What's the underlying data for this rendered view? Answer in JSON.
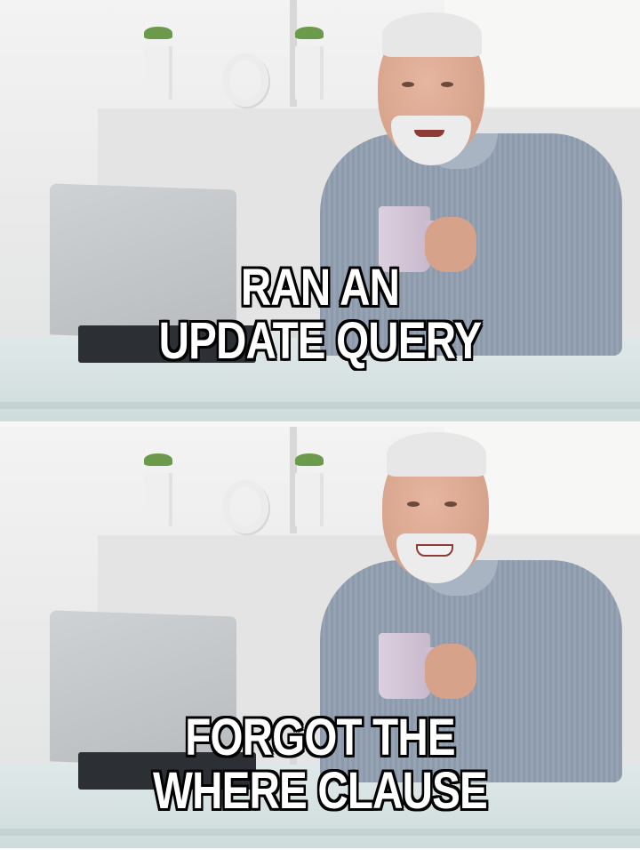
{
  "meme": {
    "top_caption": {
      "line1": "RAN AN",
      "line2": "UPDATE QUERY"
    },
    "bottom_caption": {
      "line1": "FORGOT THE",
      "line2": "WHERE CLAUSE"
    }
  },
  "colors": {
    "caption_fill": "#ffffff",
    "caption_outline": "#000000",
    "shirt": "#8c9aab",
    "mug": "#dcd0df"
  }
}
